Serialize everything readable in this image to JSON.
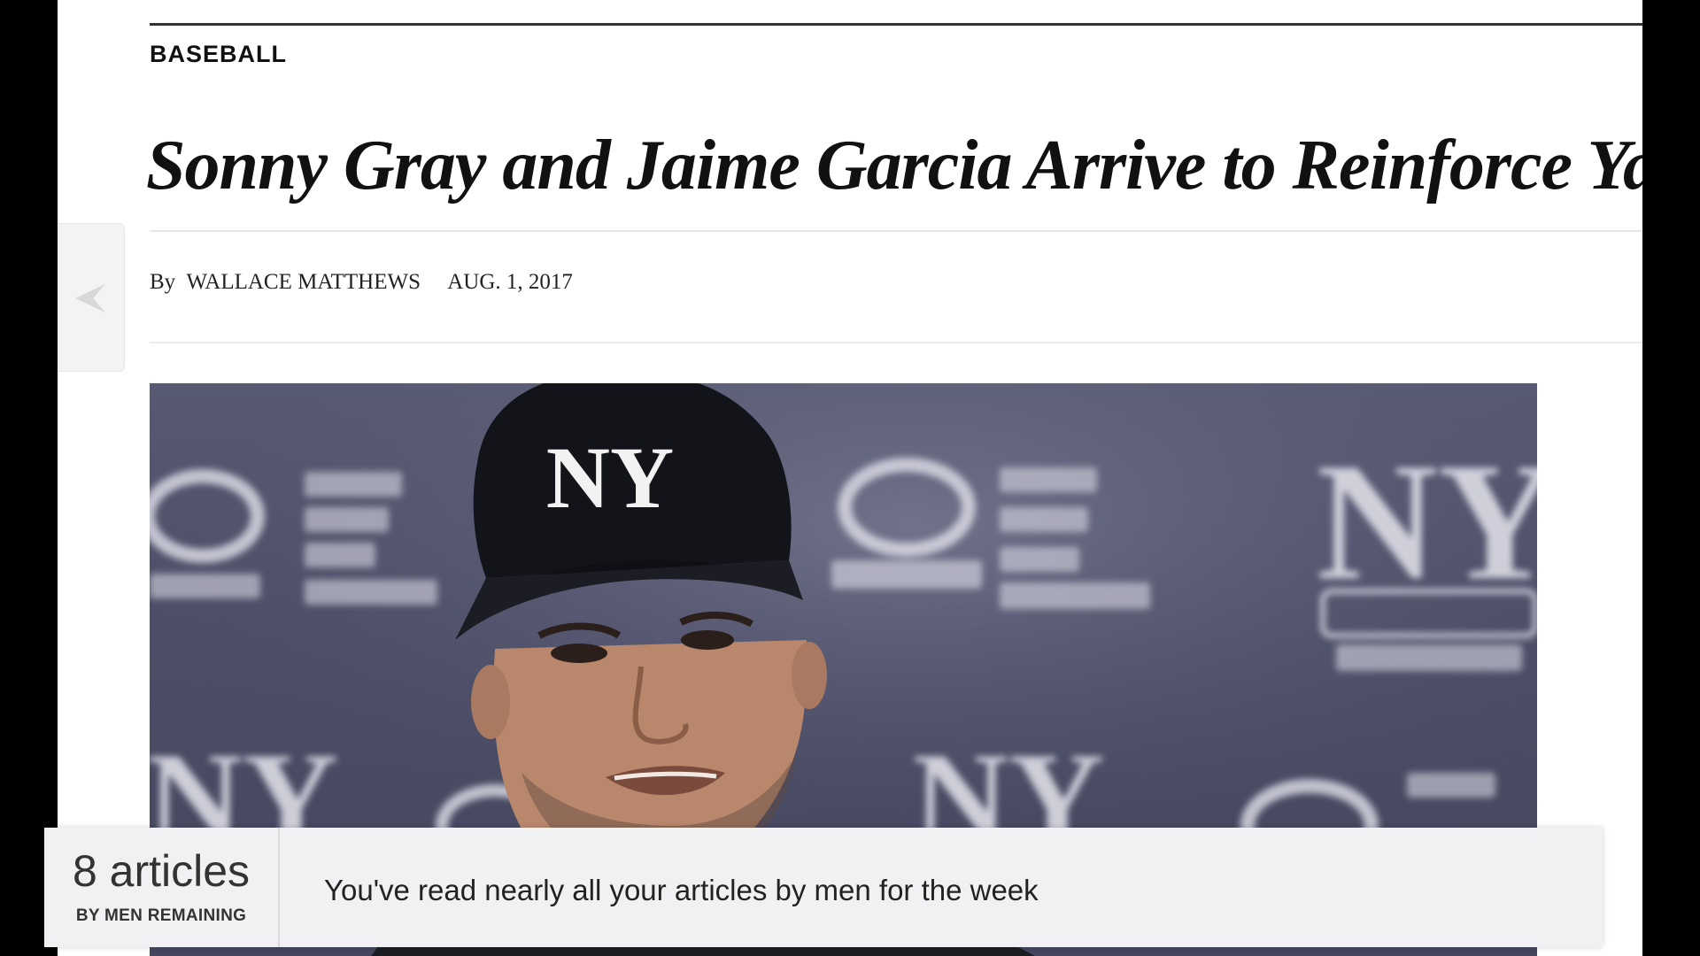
{
  "article": {
    "section": "BASEBALL",
    "headline": "Sonny Gray and Jaime Garcia Arrive to Reinforce Yan",
    "byline_prefix": "By",
    "author": "WALLACE MATTHEWS",
    "date": "AUG. 1, 2017"
  },
  "navigation": {
    "prev_icon": "chevron-left-icon"
  },
  "photo": {
    "subject": "baseball-player-photo",
    "cap_logo": "NY"
  },
  "meter": {
    "count": "8 articles",
    "count_sub": "BY MEN REMAINING",
    "message": "You've read nearly all your articles by men for the week"
  },
  "colors": {
    "background_frame": "#000000",
    "page": "#ffffff",
    "backdrop": "#4d4f68",
    "meter_bg": "#f1f0f2"
  }
}
